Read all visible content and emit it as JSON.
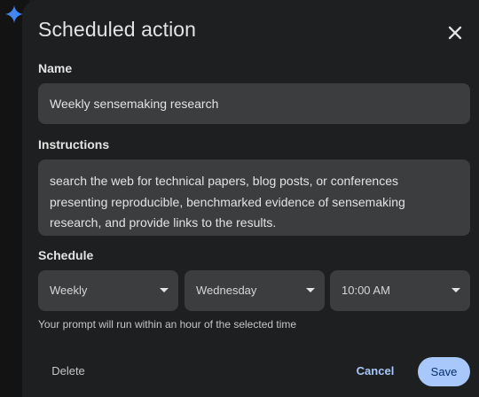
{
  "dialog": {
    "title": "Scheduled action",
    "close_icon": "close-icon"
  },
  "name": {
    "label": "Name",
    "value": "Weekly sensemaking research"
  },
  "instructions": {
    "label": "Instructions",
    "value": "search the web for technical papers, blog posts, or conferences presenting reproducible, benchmarked evidence of sensemaking research, and provide links to the results."
  },
  "schedule": {
    "label": "Schedule",
    "frequency": "Weekly",
    "day": "Wednesday",
    "time": "10:00 AM",
    "hint": "Your prompt will run within an hour of the selected time"
  },
  "actions": {
    "delete_label": "Delete",
    "cancel_label": "Cancel",
    "save_label": "Save"
  },
  "colors": {
    "accent": "#a8c7fa",
    "spark": "#4285f4"
  }
}
